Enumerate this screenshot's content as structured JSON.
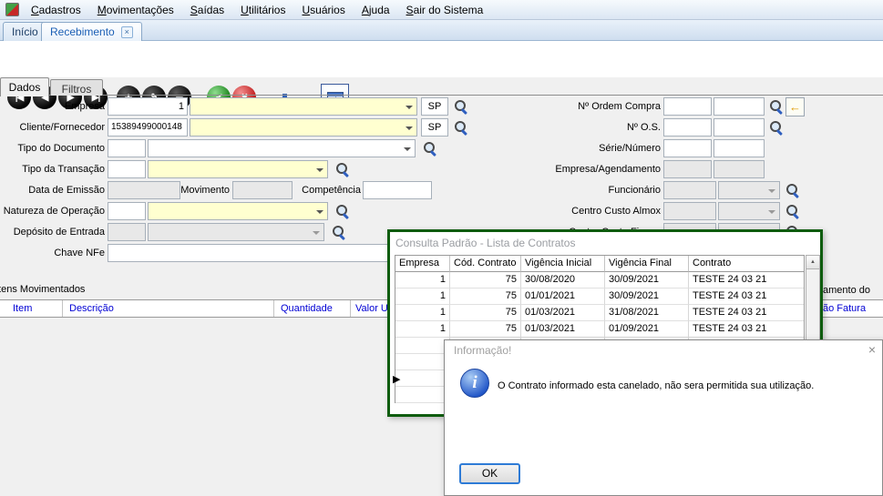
{
  "menu": {
    "items": [
      "Cadastros",
      "Movimentações",
      "Saídas",
      "Utilitários",
      "Usuários",
      "Ajuda",
      "Sair do Sistema"
    ]
  },
  "tabs": {
    "inicio": "Início",
    "recebimento": "Recebimento"
  },
  "toolbar": {
    "buttons": [
      {
        "name": "first",
        "glyph": "|◀"
      },
      {
        "name": "prev",
        "glyph": "◀"
      },
      {
        "name": "next",
        "glyph": "▶"
      },
      {
        "name": "last",
        "glyph": "▶|"
      },
      {
        "name": "add",
        "glyph": "+"
      },
      {
        "name": "edit",
        "glyph": "✎"
      },
      {
        "name": "delete",
        "glyph": "−"
      },
      {
        "name": "confirm",
        "glyph": "✔"
      },
      {
        "name": "cancel",
        "glyph": "✖"
      }
    ]
  },
  "subtabs": {
    "dados": "Dados",
    "filtros": "Filtros"
  },
  "form": {
    "empresa": {
      "label": "Empresa",
      "code": "1",
      "name": "",
      "uf": "SP"
    },
    "cliente": {
      "label": "Cliente/Fornecedor",
      "code": "15389499000148",
      "name": "",
      "uf": "SP"
    },
    "tipo_documento": {
      "label": "Tipo do Documento",
      "code": "",
      "name": ""
    },
    "tipo_transacao": {
      "label": "Tipo da Transação",
      "code": "",
      "name": ""
    },
    "data_emissao": {
      "label": "Data de Emissão",
      "value": ""
    },
    "movimento": {
      "label": "Movimento",
      "value": ""
    },
    "competencia": {
      "label": "Competência",
      "value": ""
    },
    "natureza": {
      "label": "Natureza de Operação",
      "code": "",
      "name": ""
    },
    "deposito": {
      "label": "Depósito de Entrada",
      "code": "",
      "name": ""
    },
    "chave_nfe": {
      "label": "Chave NFe",
      "value": ""
    },
    "ordem_compra": {
      "label": "Nº Ordem Compra",
      "value1": "",
      "value2": ""
    },
    "os": {
      "label": "Nº O.S.",
      "value1": "",
      "value2": ""
    },
    "serie_numero": {
      "label": "Série/Número",
      "value1": "",
      "value2": ""
    },
    "empresa_agendamento": {
      "label": "Empresa/Agendamento",
      "value1": "",
      "value2": ""
    },
    "funcionario": {
      "label": "Funcionário",
      "code": "",
      "name": ""
    },
    "centro_custo_almox": {
      "label": "Centro Custo Almox",
      "code": "",
      "name": ""
    },
    "centro_custo_financ": {
      "label": "Centro Custo Financ",
      "code": "",
      "name": ""
    }
  },
  "itens": {
    "section_label": "Itens Movimentados",
    "columns": [
      "Item",
      "Descrição",
      "Quantidade",
      "Valor Unitário"
    ],
    "fragment_top": "amento do",
    "fragment_bottom": "ão Fatura"
  },
  "consulta": {
    "title": "Consulta Padrão - Lista de Contratos",
    "columns": [
      "Empresa",
      "Cód. Contrato",
      "Vigência Inicial",
      "Vigência Final",
      "Contrato"
    ],
    "rows": [
      {
        "empresa": "1",
        "cod": "75",
        "inicial": "30/08/2020",
        "final": "30/09/2021",
        "contrato": "TESTE 24 03 21"
      },
      {
        "empresa": "1",
        "cod": "75",
        "inicial": "01/01/2021",
        "final": "30/09/2021",
        "contrato": "TESTE 24 03 21"
      },
      {
        "empresa": "1",
        "cod": "75",
        "inicial": "01/03/2021",
        "final": "31/08/2021",
        "contrato": "TESTE 24 03 21"
      },
      {
        "empresa": "1",
        "cod": "75",
        "inicial": "01/03/2021",
        "final": "01/09/2021",
        "contrato": "TESTE 24 03 21"
      }
    ]
  },
  "dialog": {
    "title": "Informação!",
    "message": "O Contrato informado esta canelado, não sera permitida sua utilização.",
    "ok": "OK"
  },
  "icons": {
    "close_tab": "×",
    "dialog_close": "×",
    "info": "i",
    "row_indicator": "▶",
    "scroll_up": "▲",
    "scroll_down": "▼",
    "back_arrow": "←"
  }
}
